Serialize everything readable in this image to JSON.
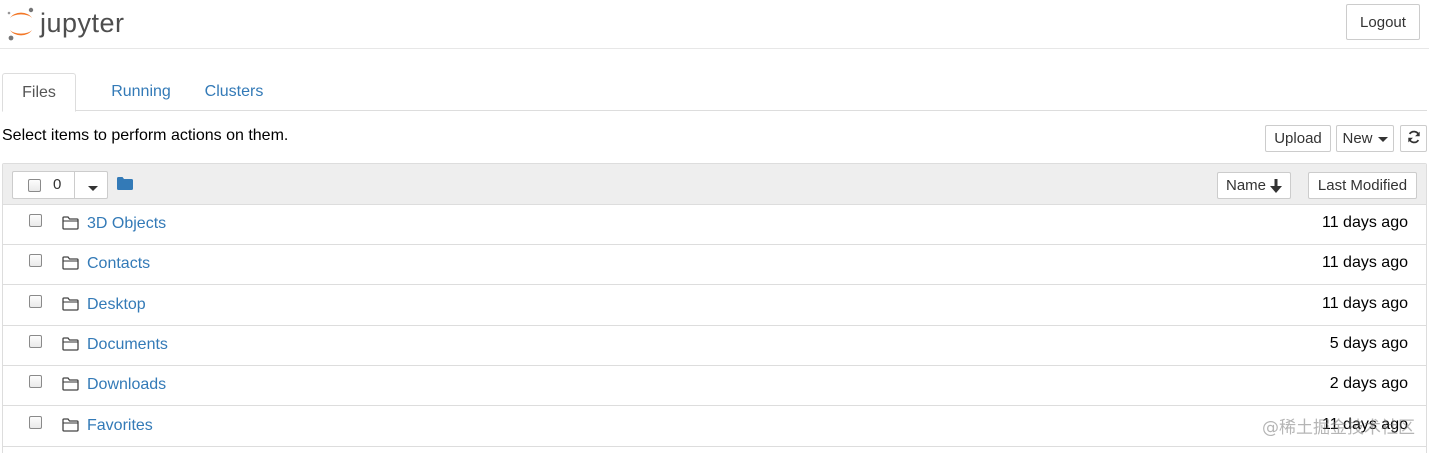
{
  "header": {
    "logo_text": "jupyter",
    "logout_label": "Logout",
    "brand_color": "#f37726"
  },
  "tabs": [
    {
      "label": "Files",
      "active": true
    },
    {
      "label": "Running",
      "active": false
    },
    {
      "label": "Clusters",
      "active": false
    }
  ],
  "toolbar": {
    "instructions": "Select items to perform actions on them.",
    "upload_label": "Upload",
    "new_label": "New",
    "refresh_icon": "refresh-icon"
  },
  "list_header": {
    "selected_count": "0",
    "name_sort_label": "Name",
    "sort_icon": "arrow-down-icon",
    "last_modified_label": "Last Modified"
  },
  "rows": [
    {
      "name": "3D Objects",
      "modified": "11 days ago",
      "icon": "folder-icon"
    },
    {
      "name": "Contacts",
      "modified": "11 days ago",
      "icon": "folder-icon"
    },
    {
      "name": "Desktop",
      "modified": "11 days ago",
      "icon": "folder-icon"
    },
    {
      "name": "Documents",
      "modified": "5 days ago",
      "icon": "folder-icon"
    },
    {
      "name": "Downloads",
      "modified": "2 days ago",
      "icon": "folder-icon"
    },
    {
      "name": "Favorites",
      "modified": "11 days ago",
      "icon": "folder-icon"
    }
  ],
  "watermark": "@稀土掘金技术社区",
  "colors": {
    "link": "#337ab7",
    "header_bg": "#eeeeee",
    "border": "#dddddd"
  }
}
